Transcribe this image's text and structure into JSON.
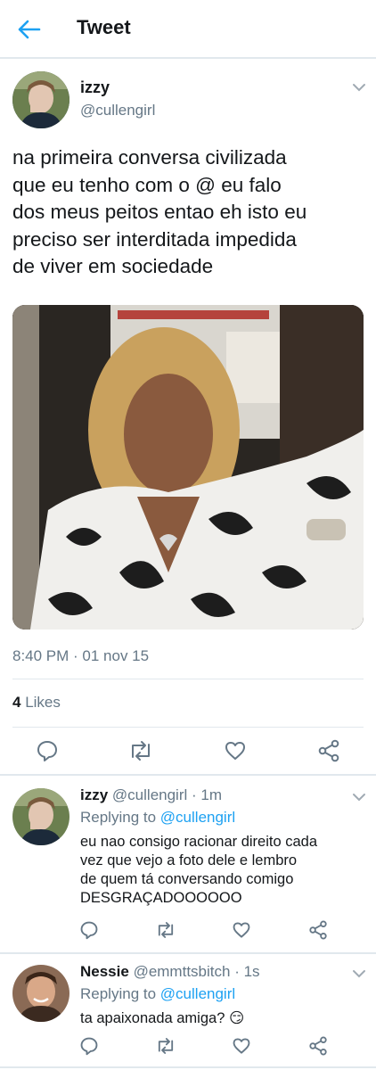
{
  "header": {
    "title": "Tweet"
  },
  "tweet": {
    "author_name": "izzy",
    "author_handle": "@cullengirl",
    "text_lines": [
      "na primeira conversa civilizada",
      "que eu tenho com o @ eu falo",
      "dos meus peitos entao eh isto eu",
      "preciso ser interditada impedida",
      "de viver em sociedade"
    ],
    "timestamp": "8:40 PM · 01 nov 15",
    "likes_count": "4",
    "likes_label": "Likes"
  },
  "replies": [
    {
      "author_name": "izzy",
      "author_handle": "@cullengirl",
      "time": "· 1m",
      "replying_prefix": "Replying to",
      "replying_handle": "@cullengirl",
      "text_lines": [
        "eu nao consigo racionar direito cada",
        "vez que vejo a foto dele e lembro",
        "de quem tá conversando comigo",
        "DESGRAÇADOOOOOO"
      ]
    },
    {
      "author_name": "Nessie",
      "author_handle": "@emmttsbitch",
      "time": "· 1s",
      "replying_prefix": "Replying to",
      "replying_handle": "@cullengirl",
      "text_lines": [
        "ta apaixonada amiga? 😏"
      ]
    }
  ],
  "colors": {
    "accent": "#1da1f2",
    "text": "#14171a",
    "muted": "#657786",
    "divider": "#e1e8ed"
  },
  "icons": [
    "back-arrow-icon",
    "chevron-down-icon",
    "reply-icon",
    "retweet-icon",
    "like-icon",
    "share-icon"
  ]
}
